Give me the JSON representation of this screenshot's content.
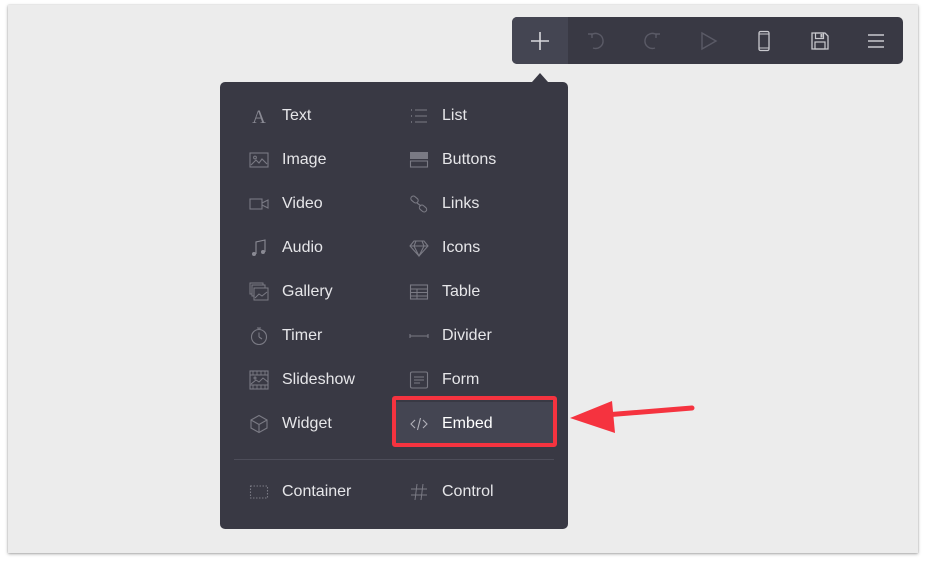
{
  "toolbar": {
    "buttons": [
      {
        "name": "add",
        "icon": "plus-icon",
        "active": true,
        "enabled": true
      },
      {
        "name": "undo",
        "icon": "undo-icon",
        "enabled": false
      },
      {
        "name": "redo",
        "icon": "redo-icon",
        "enabled": false
      },
      {
        "name": "preview",
        "icon": "play-icon",
        "enabled": false
      },
      {
        "name": "mobile-view",
        "icon": "mobile-icon",
        "enabled": true
      },
      {
        "name": "save",
        "icon": "save-icon",
        "enabled": true
      },
      {
        "name": "menu",
        "icon": "hamburger-icon",
        "enabled": true
      }
    ]
  },
  "menu": {
    "items_left": [
      {
        "label": "Text",
        "icon": "text-icon"
      },
      {
        "label": "Image",
        "icon": "image-icon"
      },
      {
        "label": "Video",
        "icon": "video-icon"
      },
      {
        "label": "Audio",
        "icon": "audio-icon"
      },
      {
        "label": "Gallery",
        "icon": "gallery-icon"
      },
      {
        "label": "Timer",
        "icon": "timer-icon"
      },
      {
        "label": "Slideshow",
        "icon": "slideshow-icon"
      },
      {
        "label": "Widget",
        "icon": "widget-icon"
      }
    ],
    "items_right": [
      {
        "label": "List",
        "icon": "list-icon"
      },
      {
        "label": "Buttons",
        "icon": "buttons-icon"
      },
      {
        "label": "Links",
        "icon": "link-icon"
      },
      {
        "label": "Icons",
        "icon": "diamond-icon"
      },
      {
        "label": "Table",
        "icon": "table-icon"
      },
      {
        "label": "Divider",
        "icon": "divider-icon"
      },
      {
        "label": "Form",
        "icon": "form-icon"
      },
      {
        "label": "Embed",
        "icon": "code-icon",
        "highlighted": true
      }
    ],
    "footer": [
      {
        "label": "Container",
        "icon": "container-icon"
      },
      {
        "label": "Control",
        "icon": "hash-icon"
      }
    ]
  },
  "annotation": {
    "highlight_color": "#f5333f",
    "target": "Embed"
  }
}
